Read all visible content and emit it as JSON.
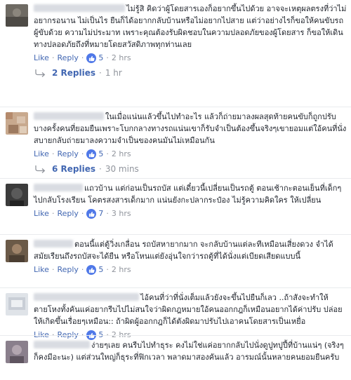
{
  "labels": {
    "like": "Like",
    "reply": "Reply",
    "dot": "·"
  },
  "comments": [
    {
      "text": "ไม่รู้สิ คิดว่าผู้โดยสารเองก็อยากขึ้นไปด้วย อาจจะเหตุผลตรงที่ว่าไม่อยากรอนาน ไม่เป็นไร ยืนก็ได้อยากกลับบ้านหรือไม่อยากไปสาย แต่ว่าอย่างไรก็ขอให้คนขับรถผู้ขับด้วย ความไม่ประมาท เพราะคุณต้องรับผิดชอบในความปลอดภัยของผู้โดยสาร ก็ขอให้เดินทางปลอดภัยถึงที่หมายโดยสวัสดิภาพทุกท่านเลย",
      "reactions": "5",
      "time": "2 hrs",
      "replies_label": "2 Replies",
      "replies_time": "1 hr"
    },
    {
      "text": "ในเมื่อแน่นแล้วขึ้นไปทำอะไร แล้วก็ถ่ายมาลงผลสุดท้ายคนขับก็ถูกปรับ บางครั้งคนที่ยอมยืนเพราะโบกกลางทางรถแน่นเขาก็รับจำเป็นต้องขึ้นจริงๆเขายอมแต่ใอ้คนที่นั่งสบายกลับถ่ายมาลงความจำเป็นของคนมันไม่เหมือนกัน",
      "reactions": "5",
      "time": "2 hrs",
      "replies_label": "6 Replies",
      "replies_time": "30 mins"
    },
    {
      "text": "แถวบ้าน แต่ก่อนเป็นรถบัส แต่เดี๋ยวนี้เปลี่ยนเป็นรถตู้ ตอนเช้ากะตอนเย็นที่เด็กๆไปกลับโรงเรียน โคตรสงสารเด็กมาก แน่นยังกะปลากระป๋อง ไม่รู้ความคิดใคร ให้เปลี่ยน",
      "reactions": "7",
      "time": "3 hrs"
    },
    {
      "text": "ตอนนี้แต่ตู้วิ่งเกลื่อน รถบัสหายากมาก จะกลับบ้านแต่ละทีเหมือนเสี่ยงดวง จำได้สมัยเรียนถึงรถบัสจะได้ยืน หรือโหนแต่ยังอุ่นใจกว่ารถตู้ที่ได้นั่งแต่เบียดเสียดแบบนี้",
      "reactions": "5",
      "time": "2 hrs"
    },
    {
      "text": "ไอ้คนที่ว่าที่นั่งเต็มแล้วยังจะขึ้นไปยืนก็เลว ..ถ้าสังจะทำให้ตายโหงทั้งคันแค่อยากรีบไปไม่สนใจว่าผิดกฎหมายใอ้คนออกกฎก็เหมือนอยากได้ค่าปรับ ปล่อยให้เกิดขึ้นเรื่อยๆเหมือน:: ถ้าผิดผู้ออกกฎก็ได้ตังผิดมาปรับไปเอาคนโดยสารเป็นเหยื่อ",
      "reactions": "5",
      "time": "2 hrs"
    },
    {
      "text": "ง่ายๆเลย คนรีบไปทำธุระ คงไม่ใช่แค่อยากกลับไปนั่งดูปูทปูปี้ที่บ้านแน่ๆ (จริงๆก็คงมีอะนะ) แต่ส่วนใหญ่ก็ธุระที่ฟิกเวลา พลาดมาสองคันแล้ว อารมณ์นั้นหลายคนยอมยืนครับ"
    }
  ],
  "colors": {
    "link": "#4267b2",
    "meta": "#90949c",
    "like_badge": "#4f78e8",
    "divider": "#e9ebee"
  }
}
